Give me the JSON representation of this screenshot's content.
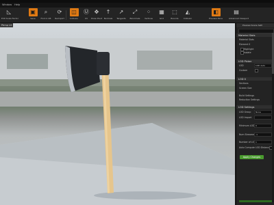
{
  "menu": [
    "Window",
    "Help"
  ],
  "toolbar": [
    {
      "label": "Edit Scale Factor",
      "icon": "triangle-ruler-icon"
    },
    {
      "label": "Save",
      "icon": "save-icon"
    },
    {
      "label": "Find in CB",
      "icon": "find-in-content-browser-icon"
    },
    {
      "label": "Reimport",
      "icon": "reimport-icon"
    },
    {
      "label": "Collision",
      "icon": "collision-icon"
    },
    {
      "label": "UV",
      "icon": "uv-icon"
    },
    {
      "label": "Show Pivot",
      "icon": "pivot-icon"
    },
    {
      "label": "Normals",
      "icon": "normals-icon"
    },
    {
      "label": "Tangents",
      "icon": "tangents-icon"
    },
    {
      "label": "Binormals",
      "icon": "binormals-icon"
    },
    {
      "label": "Vertices",
      "icon": "vertices-icon"
    },
    {
      "label": "Grid",
      "icon": "grid-icon"
    },
    {
      "label": "Bounds",
      "icon": "bounds-icon"
    },
    {
      "label": "Collision",
      "icon": "collision-view-icon"
    },
    {
      "label": "Preview Pane",
      "icon": "preview-icon"
    },
    {
      "label": "Advanced Viewport",
      "icon": "advanced-viewport-icon"
    }
  ],
  "viewport": {
    "tag": "Persp Lit"
  },
  "panel": {
    "tab": "Preview Scene Sett",
    "sections": {
      "material": "Material Slots",
      "lod_picker": "LOD Picker",
      "lod0": "LOD 0",
      "lod_settings": "LOD Settings"
    },
    "rows": {
      "material_slots": "Material Slots",
      "element0": "Element 0",
      "highlight": "Highlight",
      "isolate": "Isolate",
      "lod": "LOD",
      "custom": "Custom",
      "sections": "Sections",
      "screen_size": "Screen Size",
      "build_settings": "Build Settings",
      "reduction_settings": "Reduction Settings",
      "lod_group": "LOD Group",
      "lod_import": "LOD Import",
      "minimum_lod": "Minimum LOD",
      "num_streamed_lods": "Num Streamed LODs",
      "number_of_lods": "Number of LODs",
      "auto_compute": "Auto Compute LOD Distances"
    },
    "fields": {
      "lod": "LOD Auto",
      "lod_group": "None",
      "lod_import": "",
      "minimum_lod": "0",
      "num_streamed": "-1",
      "number_of_lods": "1"
    },
    "apply_button": "Apply Changes"
  }
}
